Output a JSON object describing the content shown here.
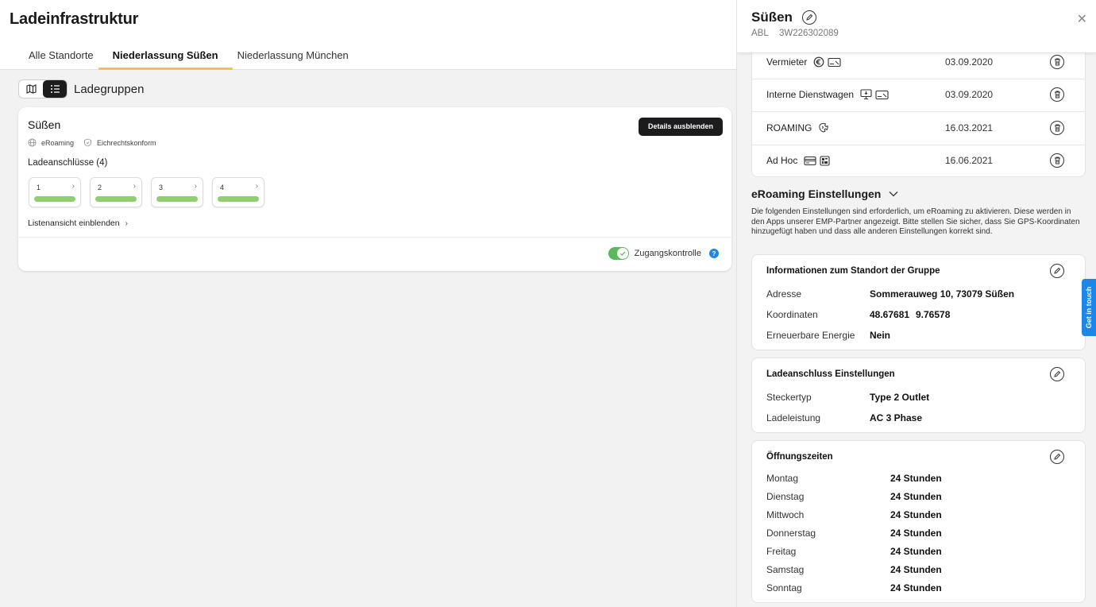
{
  "page": {
    "title": "Ladeinfrastruktur"
  },
  "tabs": [
    {
      "label": "Alle Standorte"
    },
    {
      "label": "Niederlassung Süßen"
    },
    {
      "label": "Niederlassung München"
    }
  ],
  "view": {
    "title": "Ladegruppen"
  },
  "group": {
    "name": "Süßen",
    "tags": [
      "eRoaming",
      "Eichrechtskonform"
    ],
    "details_button": "Details ausblenden",
    "connectors_title": "Ladeanschlüsse (4)",
    "connectors": [
      {
        "label": "1",
        "status_color": "#8fcf6d"
      },
      {
        "label": "2",
        "status_color": "#8fcf6d"
      },
      {
        "label": "3",
        "status_color": "#8fcf6d"
      },
      {
        "label": "4",
        "status_color": "#8fcf6d"
      }
    ],
    "list_link": "Listenansicht einblenden",
    "access_label": "Zugangskontrolle",
    "access_enabled": true
  },
  "panel": {
    "title": "Süßen",
    "brand": "ABL",
    "serial": "3W226302089",
    "tariffs": [
      {
        "name": "Vermieter",
        "date": "03.09.2020",
        "icons": [
          "euro-icon",
          "card-icon"
        ]
      },
      {
        "name": "Interne Dienstwagen",
        "date": "03.09.2020",
        "icons": [
          "monitor-icon",
          "card-icon"
        ]
      },
      {
        "name": "ROAMING",
        "date": "16.03.2021",
        "icons": [
          "roaming-icon"
        ]
      },
      {
        "name": "Ad Hoc",
        "date": "16.06.2021",
        "icons": [
          "credit-card-icon",
          "qr-icon"
        ]
      }
    ],
    "eroaming": {
      "title": "eRoaming Einstellungen",
      "description": "Die folgenden Einstellungen sind erforderlich, um eRoaming zu aktivieren. Diese werden in den Apps unserer EMP-Partner angezeigt. Bitte stellen Sie sicher, dass Sie GPS-Koordinaten hinzugefügt haben und dass alle anderen Einstellungen korrekt sind."
    },
    "location": {
      "title": "Informationen zum Standort der Gruppe",
      "address_label": "Adresse",
      "address": "Sommerauweg 10, 73079 Süßen",
      "coords_label": "Koordinaten",
      "lat": "48.67681",
      "lon": "9.76578",
      "renewable_label": "Erneuerbare Energie",
      "renewable": "Nein"
    },
    "connector_settings": {
      "title": "Ladeanschluss Einstellungen",
      "plug_label": "Steckertyp",
      "plug": "Type 2 Outlet",
      "power_label": "Ladeleistung",
      "power": "AC 3 Phase"
    },
    "hours": {
      "title": "Öffnungszeiten",
      "days": [
        {
          "day": "Montag",
          "value": "24 Stunden"
        },
        {
          "day": "Dienstag",
          "value": "24 Stunden"
        },
        {
          "day": "Mittwoch",
          "value": "24 Stunden"
        },
        {
          "day": "Donnerstag",
          "value": "24 Stunden"
        },
        {
          "day": "Freitag",
          "value": "24 Stunden"
        },
        {
          "day": "Samstag",
          "value": "24 Stunden"
        },
        {
          "day": "Sonntag",
          "value": "24 Stunden"
        }
      ]
    }
  },
  "get_in_touch": "Get in touch",
  "colors": {
    "accent_tab": "#f0c24b",
    "status_ok": "#8fcf6d",
    "toggle_on": "#5cb85c",
    "help": "#1e86e6",
    "dark_button": "#1c1c1e"
  }
}
